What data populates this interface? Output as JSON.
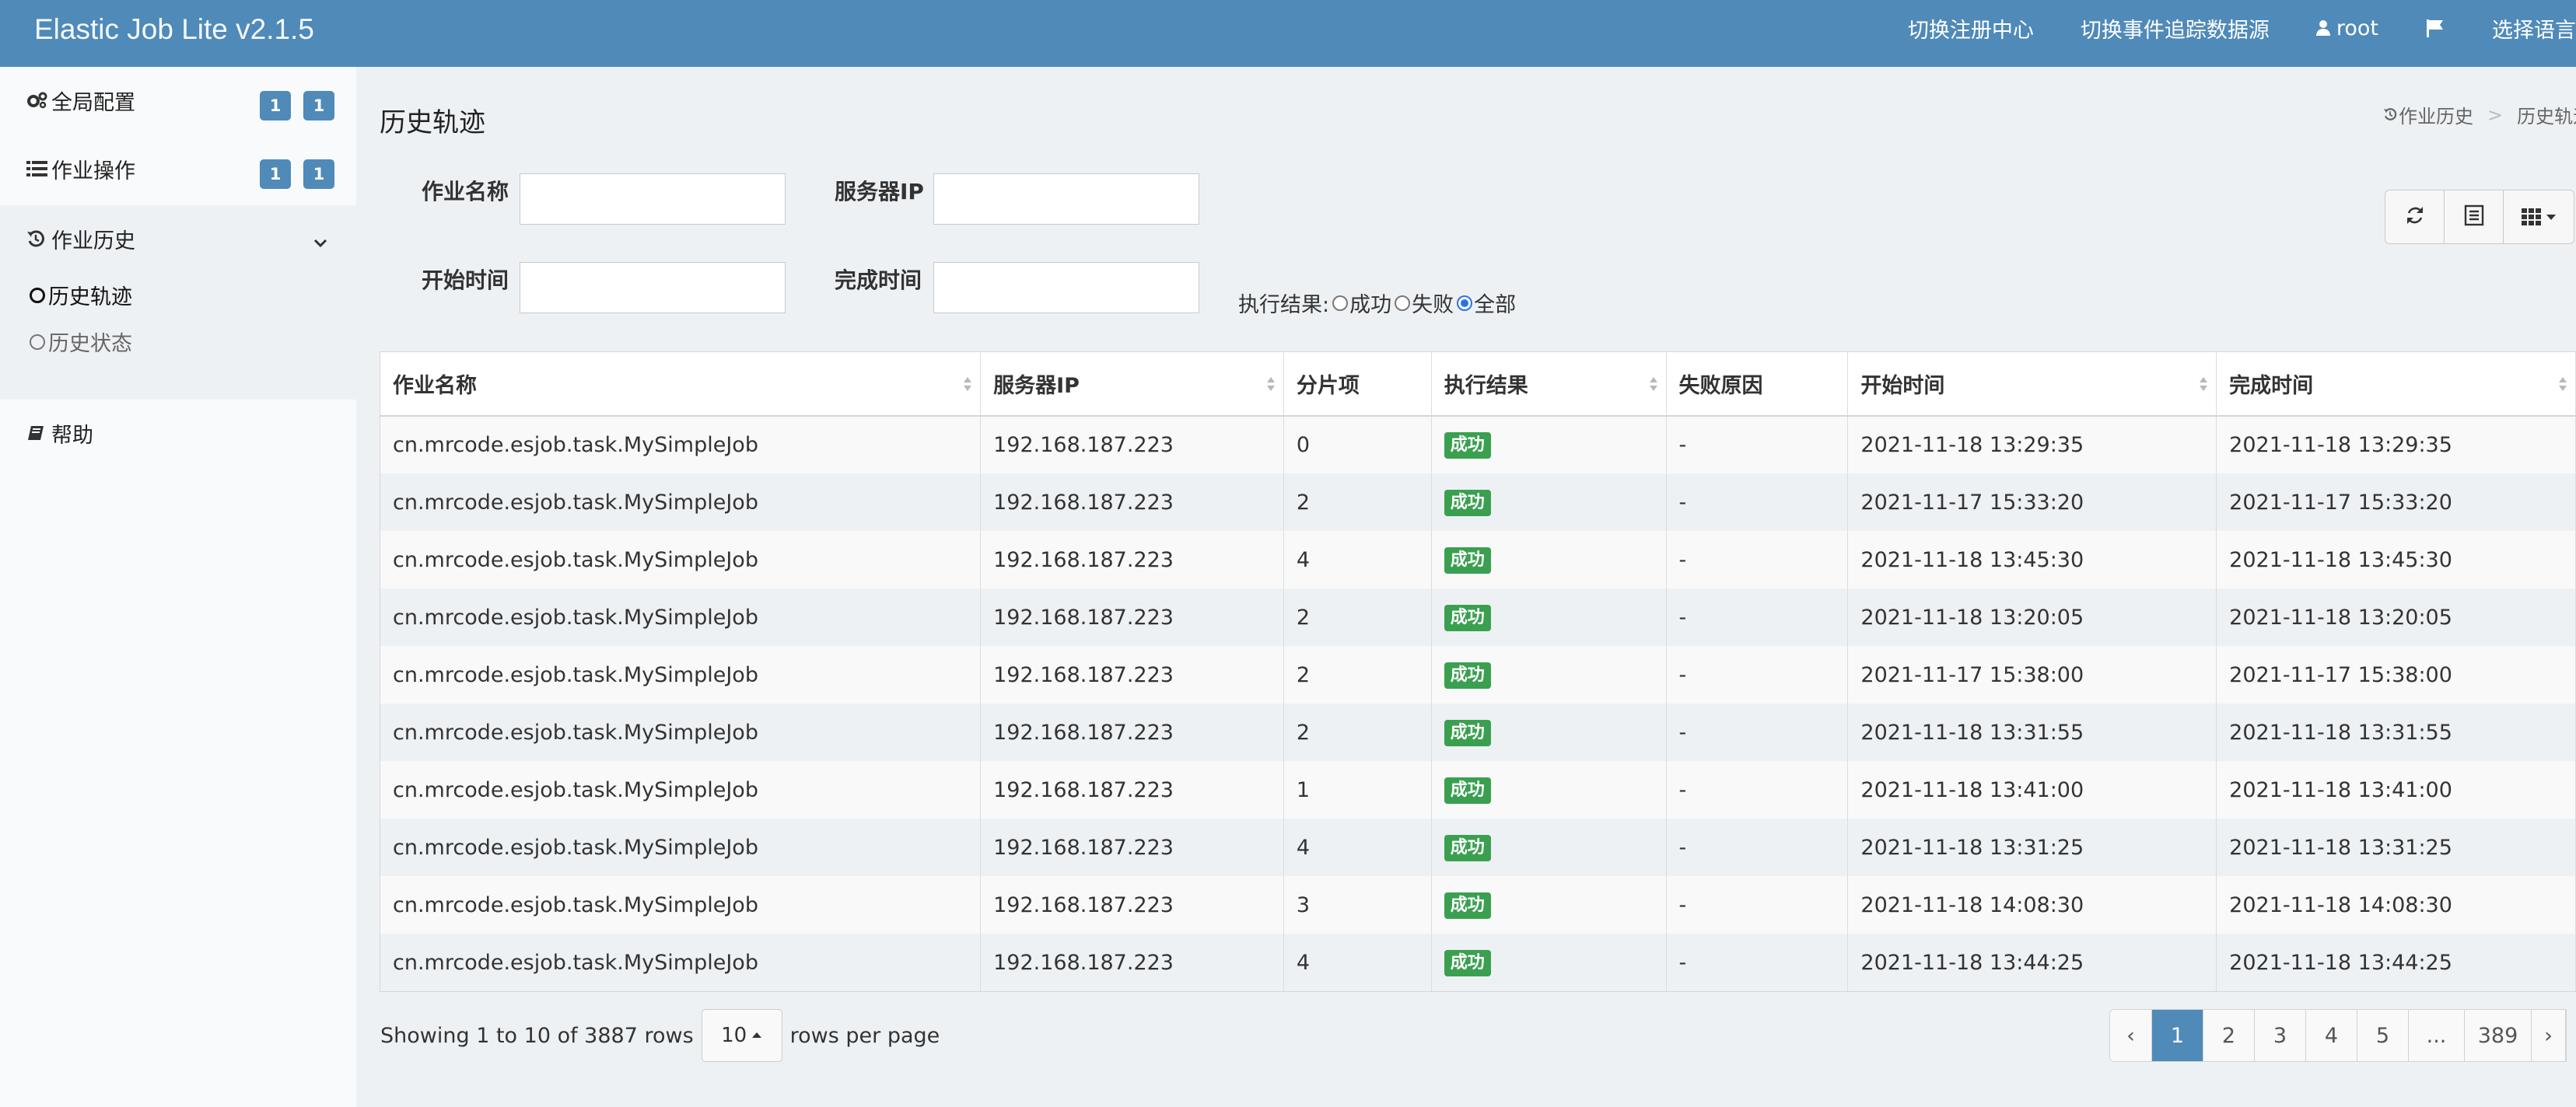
{
  "navbar": {
    "brand": "Elastic Job Lite v2.1.5",
    "switch_registry": "切换注册中心",
    "switch_datasource": "切换事件追踪数据源",
    "user": "root",
    "language": "选择语言"
  },
  "sidebar": {
    "global_config": {
      "label": "全局配置",
      "badges": [
        "1",
        "1"
      ]
    },
    "job_ops": {
      "label": "作业操作",
      "badges": [
        "1",
        "1"
      ]
    },
    "job_history": {
      "label": "作业历史",
      "children": [
        {
          "label": "历史轨迹",
          "active": true
        },
        {
          "label": "历史状态",
          "active": false
        }
      ]
    },
    "help": {
      "label": "帮助"
    }
  },
  "page": {
    "title": "历史轨迹",
    "breadcrumb": [
      "作业历史",
      "历史轨迹"
    ]
  },
  "filters": {
    "job_name_label": "作业名称",
    "server_ip_label": "服务器IP",
    "start_time_label": "开始时间",
    "complete_time_label": "完成时间",
    "job_name_value": "",
    "server_ip_value": "",
    "start_time_value": "",
    "complete_time_value": "",
    "result_label": "执行结果:",
    "result_options": [
      "成功",
      "失败",
      "全部"
    ],
    "result_selected": "全部"
  },
  "table": {
    "columns": [
      "作业名称",
      "服务器IP",
      "分片项",
      "执行结果",
      "失败原因",
      "开始时间",
      "完成时间"
    ],
    "rows": [
      [
        "cn.mrcode.esjob.task.MySimpleJob",
        "192.168.187.223",
        "0",
        "成功",
        "-",
        "2021-11-18 13:29:35",
        "2021-11-18 13:29:35"
      ],
      [
        "cn.mrcode.esjob.task.MySimpleJob",
        "192.168.187.223",
        "2",
        "成功",
        "-",
        "2021-11-17 15:33:20",
        "2021-11-17 15:33:20"
      ],
      [
        "cn.mrcode.esjob.task.MySimpleJob",
        "192.168.187.223",
        "4",
        "成功",
        "-",
        "2021-11-18 13:45:30",
        "2021-11-18 13:45:30"
      ],
      [
        "cn.mrcode.esjob.task.MySimpleJob",
        "192.168.187.223",
        "2",
        "成功",
        "-",
        "2021-11-18 13:20:05",
        "2021-11-18 13:20:05"
      ],
      [
        "cn.mrcode.esjob.task.MySimpleJob",
        "192.168.187.223",
        "2",
        "成功",
        "-",
        "2021-11-17 15:38:00",
        "2021-11-17 15:38:00"
      ],
      [
        "cn.mrcode.esjob.task.MySimpleJob",
        "192.168.187.223",
        "2",
        "成功",
        "-",
        "2021-11-18 13:31:55",
        "2021-11-18 13:31:55"
      ],
      [
        "cn.mrcode.esjob.task.MySimpleJob",
        "192.168.187.223",
        "1",
        "成功",
        "-",
        "2021-11-18 13:41:00",
        "2021-11-18 13:41:00"
      ],
      [
        "cn.mrcode.esjob.task.MySimpleJob",
        "192.168.187.223",
        "4",
        "成功",
        "-",
        "2021-11-18 13:31:25",
        "2021-11-18 13:31:25"
      ],
      [
        "cn.mrcode.esjob.task.MySimpleJob",
        "192.168.187.223",
        "3",
        "成功",
        "-",
        "2021-11-18 14:08:30",
        "2021-11-18 14:08:30"
      ],
      [
        "cn.mrcode.esjob.task.MySimpleJob",
        "192.168.187.223",
        "4",
        "成功",
        "-",
        "2021-11-18 13:44:25",
        "2021-11-18 13:44:25"
      ]
    ]
  },
  "pagination": {
    "showing_text": "Showing 1 to 10 of 3887 rows",
    "page_size": "10",
    "rows_per_page_text": "rows per page",
    "prev": "‹",
    "pages": [
      "1",
      "2",
      "3",
      "4",
      "5",
      "...",
      "389"
    ],
    "current": "1",
    "next": "›"
  },
  "colors": {
    "navbar": "#4f8ab9",
    "badge": "#4f8ab9",
    "success_label": "#3aa050",
    "page_bg": "#eef1f4"
  },
  "icons": {
    "global_config": "gears-icon",
    "job_ops": "list-icon",
    "job_history": "history-icon",
    "help": "book-icon",
    "user": "user-icon",
    "language": "flag-icon",
    "refresh": "refresh-icon",
    "toggle": "list-alt-icon",
    "columns": "grid-icon"
  }
}
